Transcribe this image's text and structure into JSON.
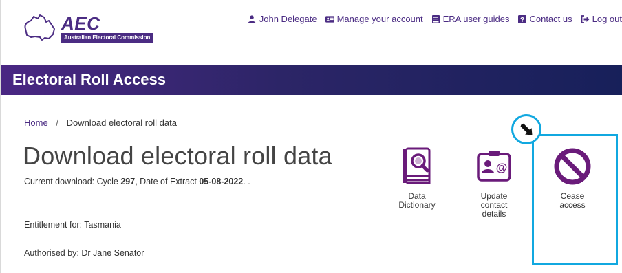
{
  "logo": {
    "acronym": "AEC",
    "name": "Australian Electoral Commission"
  },
  "topnav": {
    "user": "John Delegate",
    "manage": "Manage your account",
    "guides": "ERA user guides",
    "contact": "Contact us",
    "logout": "Log out"
  },
  "banner": {
    "title": "Electoral Roll Access"
  },
  "breadcrumb": {
    "home": "Home",
    "separator": "/",
    "current": "Download electoral roll data"
  },
  "page": {
    "title": "Download electoral roll data",
    "current_prefix": "Current download: Cycle ",
    "cycle": "297",
    "extract_prefix": ", Date of Extract ",
    "extract_date": "05-08-2022",
    "current_suffix": ". .",
    "entitlement": "Entitlement for: Tasmania",
    "authorised": "Authorised by: Dr Jane Senator"
  },
  "tiles": [
    {
      "label_line1": "Data",
      "label_line2": "Dictionary",
      "label_line3": "",
      "icon": "book-magnifier-icon"
    },
    {
      "label_line1": "Update",
      "label_line2": "contact",
      "label_line3": "details",
      "icon": "contact-card-icon"
    },
    {
      "label_line1": "Cease",
      "label_line2": "access",
      "label_line3": "",
      "icon": "prohibited-icon"
    }
  ],
  "colors": {
    "brand_purple": "#4b2c83",
    "icon_purple": "#6a1b7a",
    "highlight_blue": "#11a8e0",
    "banner_dark": "#17205a"
  }
}
